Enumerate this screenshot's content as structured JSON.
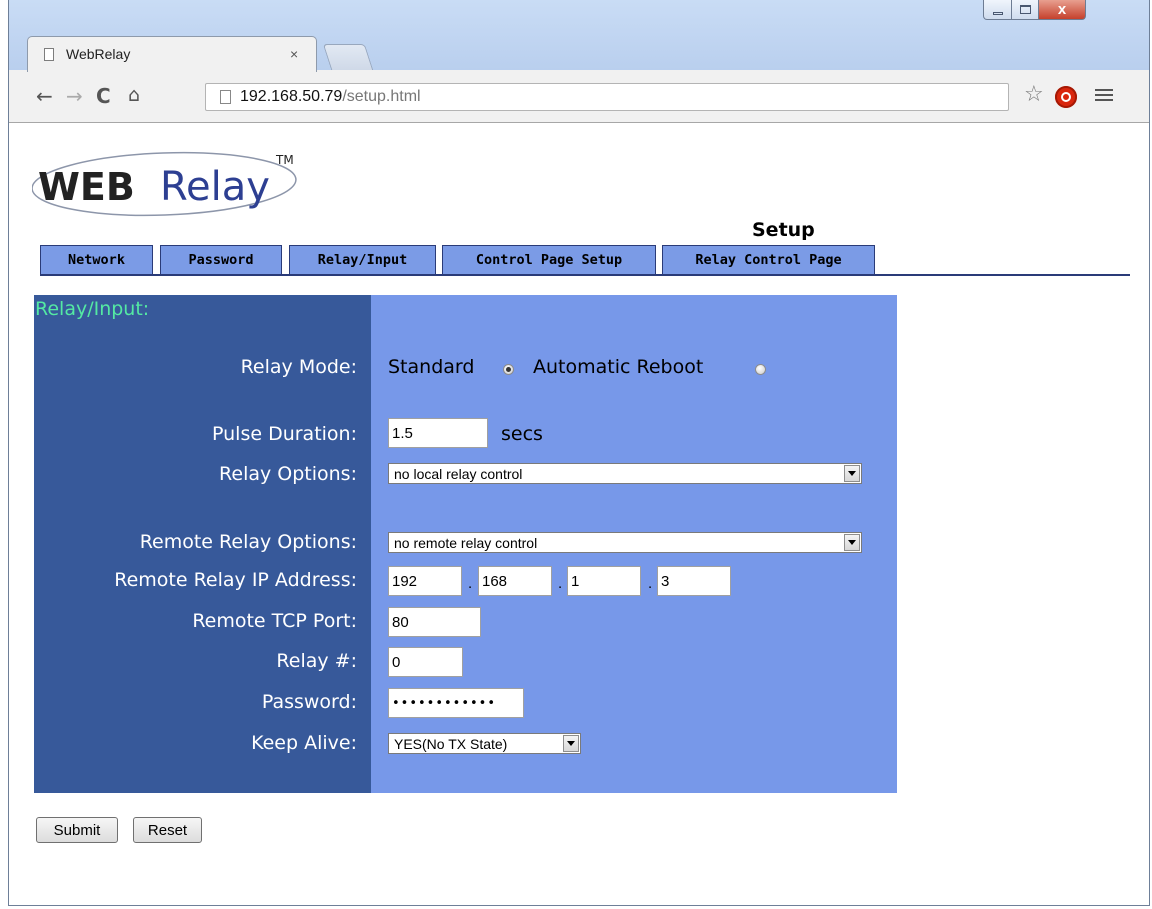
{
  "browser": {
    "tab_title": "WebRelay",
    "tab_close": "×",
    "url_host": "192.168.50.79",
    "url_path": "/setup.html",
    "window_close_glyph": "x",
    "icons": [
      "back-arrow-icon",
      "forward-arrow-icon",
      "reload-icon",
      "home-icon",
      "page-icon",
      "star-icon",
      "stop-extension-icon",
      "menu-icon"
    ]
  },
  "page": {
    "logo_web": "WEB",
    "logo_relay": "Relay",
    "logo_tm": "TM",
    "heading": "Setup",
    "tabs": [
      {
        "label": "Network"
      },
      {
        "label": "Password"
      },
      {
        "label": "Relay/Input"
      },
      {
        "label": "Control Page Setup"
      },
      {
        "label": "Relay Control Page"
      }
    ],
    "tab_color": "#7b9be6"
  },
  "form": {
    "section_title": "Relay/Input:",
    "relay_mode": {
      "label": "Relay Mode:",
      "options": [
        {
          "label": "Standard",
          "checked": true
        },
        {
          "label": "Automatic Reboot",
          "checked": false
        }
      ]
    },
    "pulse_duration": {
      "label": "Pulse Duration:",
      "value": "1.5",
      "unit": "secs"
    },
    "relay_options": {
      "label": "Relay Options:",
      "selected": "no local relay control"
    },
    "remote_relay_options": {
      "label": "Remote Relay Options:",
      "selected": "no remote relay control"
    },
    "remote_ip": {
      "label": "Remote Relay IP Address:",
      "octets": [
        "192",
        "168",
        "1",
        "3"
      ],
      "separator": "."
    },
    "remote_port": {
      "label": "Remote TCP Port:",
      "value": "80"
    },
    "relay_number": {
      "label": "Relay #:",
      "value": "0"
    },
    "password": {
      "label": "Password:",
      "value": "••••••••••••"
    },
    "keep_alive": {
      "label": "Keep Alive:",
      "selected": "YES(No TX State)"
    },
    "submit_label": "Submit",
    "reset_label": "Reset",
    "colors": {
      "left_panel": "#37599a",
      "right_panel": "#7798e9",
      "section_title": "#54e9a3",
      "label_text": "#ffffff"
    }
  }
}
